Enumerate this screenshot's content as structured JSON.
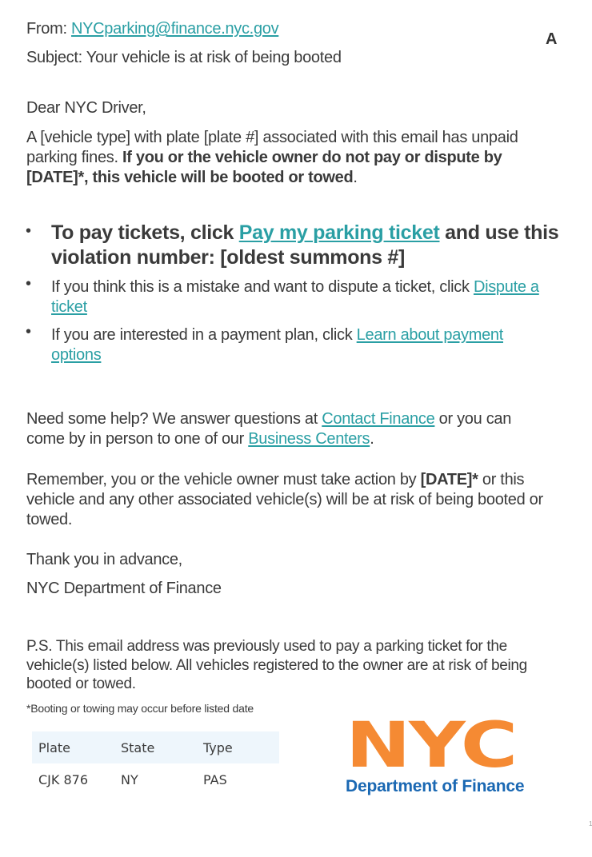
{
  "header": {
    "from_label": "From:",
    "from_email": "NYCparking@finance.nyc.gov",
    "subject_label": "Subject:",
    "subject": "Your vehicle is at risk of being booted",
    "version_badge": "A"
  },
  "body": {
    "greeting": "Dear NYC Driver,",
    "intro_plain": "A [vehicle type] with plate [plate #] associated with this email has unpaid parking fines. ",
    "intro_bold": "If you or the vehicle owner do not pay or dispute by [DATE]*, this vehicle will be booted or towed",
    "intro_end": ".",
    "bullets": [
      {
        "pre": "To pay tickets, click ",
        "link": "Pay my parking ticket",
        "post": " and use this violation number: [oldest summons #]"
      },
      {
        "pre": "If you think this is a mistake and want to dispute a ticket, click ",
        "link": "Dispute a ticket",
        "post": ""
      },
      {
        "pre": "If you are interested in a payment plan, click ",
        "link": "Learn about payment options",
        "post": ""
      }
    ],
    "help_pre": "Need some help? We answer questions at ",
    "help_link1": "Contact Finance",
    "help_mid": " or you can come by in person to one of our ",
    "help_link2": "Business Centers",
    "help_end": ".",
    "remember_pre": "Remember, you or the vehicle owner must take action by ",
    "remember_bold": "[DATE]*",
    "remember_post": " or this vehicle and any other associated vehicle(s) will be at risk of being booted or towed.",
    "closing": "Thank you in advance,",
    "signature": "NYC Department of Finance",
    "ps": "P.S. This email address was previously used to pay a parking ticket for the vehicle(s) listed below. All vehicles registered to the owner are at risk of being booted or towed.",
    "footnote": "*Booting or towing may occur before listed date"
  },
  "vehicle_table": {
    "headers": [
      "Plate",
      "State",
      "Type"
    ],
    "rows": [
      [
        "CJK 876",
        "NY",
        "PAS"
      ]
    ]
  },
  "logo": {
    "wordmark": "NYC",
    "subtitle": "Department of Finance",
    "wordmark_color": "#f58a33",
    "subtitle_color": "#1a68b3"
  },
  "page_number": "1",
  "colors": {
    "link": "#2a9fa4",
    "text": "#3a3a3a",
    "table_header_bg": "#eef6fc"
  }
}
